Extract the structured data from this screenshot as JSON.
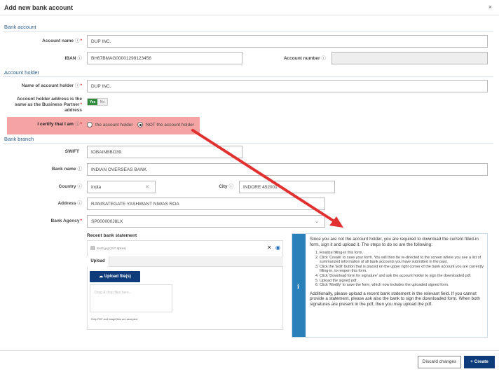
{
  "dialog": {
    "title": "Add new bank account",
    "close": "×"
  },
  "sections": {
    "bank_account": "Bank account",
    "account_holder": "Account holder",
    "bank_branch": "Bank branch"
  },
  "fields": {
    "account_name": {
      "label": "Account name",
      "value": "DUP INC."
    },
    "iban": {
      "label": "IBAN",
      "value": "BH67BMAG00001299123456"
    },
    "account_number": {
      "label": "Account number",
      "value": ""
    },
    "holder_name": {
      "label": "Name of account holder",
      "value": "DUP INC."
    },
    "same_address": {
      "label_1": "Account holder address is the",
      "label_2": "same as the Business Partner",
      "label_3": "address",
      "yes": "Yes",
      "no": "No"
    },
    "certify": {
      "label": "I certify that I am",
      "opt1": "the account holder",
      "opt2": "NOT the account holder",
      "selected": "opt2"
    },
    "swift": {
      "label": "SWIFT",
      "value": "IOBAINBBO39"
    },
    "bank_name": {
      "label": "Bank name",
      "value": "INDIAN OVERSEAS BANK"
    },
    "country": {
      "label": "Country",
      "value": "India"
    },
    "city": {
      "label": "City",
      "value": "INDORE 452001"
    },
    "address": {
      "label": "Address",
      "value": "RANISATEGATE YASHWANT NIWAS ROA"
    },
    "bank_agency": {
      "label": "Bank Agency",
      "value": "SP000000J8LX"
    }
  },
  "statement": {
    "heading": "Recent bank statement",
    "file_name": "test3.jpg (157.8pkes)",
    "tab": "Upload",
    "upload_button": "Upload file(s)",
    "drop_placeholder": "Drag & drop files here...",
    "note": "Only PDF and image files are accepted"
  },
  "info": {
    "intro": "Since you are not the account holder, you are required to download the current filled-in form, sign it and upload it. The steps to do so are the following:",
    "steps": [
      "Finalize filling-in this form.",
      "Click 'Create' to save your form. You will then be re-directed to the screen where you see a list of summarized information of all bank accounts you have submitted in the past.",
      "Click the 'Edit' button that is placed on the upper right corner of the bank account you are currently filling-in, to reopen this form.",
      "Click 'Download form for signature' and ask the account holder to sign the downloaded pdf.",
      "Upload the signed pdf.",
      "Click 'Modify' to save the form, which now includes the uploaded signed form."
    ],
    "outro": "Additionally, please upload a recent bank statement in the relevant field. If you cannot provide a statement, please ask also the bank to sign the downloaded form. When both signatures are present in the pdf, then you may upload the pdf."
  },
  "footer": {
    "discard": "Discard changes",
    "create": "Create"
  },
  "colors": {
    "primary": "#0e3c7a",
    "highlight": "#f5a4a4",
    "arrow": "#e03030",
    "info_bar": "#2a80b9"
  }
}
